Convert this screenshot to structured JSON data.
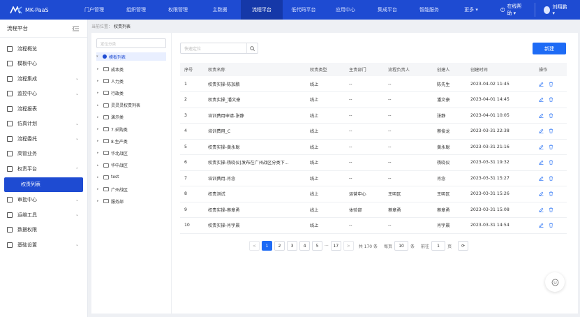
{
  "brand": {
    "name": "MK-PaaS"
  },
  "topnav": {
    "items": [
      "门户管理",
      "组织管理",
      "权限管理",
      "主数据",
      "流程平台",
      "低代码平台",
      "应用中心",
      "集成平台",
      "智能服务",
      "更多 ▾"
    ],
    "active_index": 4
  },
  "header_right": {
    "help": "在线帮助 ▾",
    "user": "刘翔鹏 ▾"
  },
  "sidebar": {
    "title": "流程平台",
    "items": [
      {
        "label": "流程概览",
        "chevron": ""
      },
      {
        "label": "模板中心",
        "chevron": ""
      },
      {
        "label": "流程集成",
        "chevron": "⌄"
      },
      {
        "label": "监控中心",
        "chevron": "⌄"
      },
      {
        "label": "流程报表",
        "chevron": ""
      },
      {
        "label": "仿真计划",
        "chevron": "⌄"
      },
      {
        "label": "流程委托",
        "chevron": "⌄"
      },
      {
        "label": "高管业务",
        "chevron": ""
      },
      {
        "label": "权责平台",
        "chevron": "⌄"
      }
    ],
    "sub_active": "权责列表",
    "items_after": [
      {
        "label": "审批中心",
        "chevron": "⌄"
      },
      {
        "label": "运维工具",
        "chevron": "⌄"
      },
      {
        "label": "数据权限",
        "chevron": ""
      },
      {
        "label": "基础设置",
        "chevron": "⌄"
      }
    ]
  },
  "breadcrumb": {
    "parent": "当前位置：",
    "current": "权责列表"
  },
  "tree": {
    "search_placeholder": "定位分类",
    "root": "模板列表",
    "nodes": [
      "成本类",
      "人力类",
      "行政类",
      "灵灵灵权责列表",
      "演示类",
      "7.采购类",
      "8.生产类",
      "华北战区",
      "华中战区",
      "test",
      "广州战区",
      "服务部"
    ]
  },
  "toolbar": {
    "search_placeholder": "快速定位",
    "new_label": "新建"
  },
  "table": {
    "headers": [
      "序号",
      "权责名称",
      "权责类型",
      "主责部门",
      "流程负责人",
      "创建人",
      "创建时间",
      "操作"
    ],
    "rows": [
      [
        "1",
        "权责实操-陈加鹏",
        "线上",
        "--",
        "--",
        "陈先生",
        "2023-04-02 11:45"
      ],
      [
        "2",
        "权责实操_潘文豪",
        "线上",
        "--",
        "--",
        "潘文豪",
        "2023-04-01 14:45"
      ],
      [
        "3",
        "培训费用申请-张静",
        "线上",
        "--",
        "--",
        "张静",
        "2023-04-01 10:05"
      ],
      [
        "4",
        "培训费用_C",
        "线上",
        "--",
        "--",
        "蔡俊龙",
        "2023-03-31 22:38"
      ],
      [
        "5",
        "权责实操-黄永聪",
        "线上",
        "--",
        "--",
        "黄永聪",
        "2023-03-31 21:16"
      ],
      [
        "6",
        "权责实操-杨晓仪[发布在广州战区分类下...",
        "线上",
        "--",
        "--",
        "杨晓仪",
        "2023-03-31 19:32"
      ],
      [
        "7",
        "培训费用-肖念",
        "线上",
        "--",
        "--",
        "肖念",
        "2023-03-31 15:27"
      ],
      [
        "8",
        "权责测试",
        "线上",
        "运营中心",
        "王明区",
        "王明区",
        "2023-03-31 15:26"
      ],
      [
        "9",
        "权责实操-蔡章勇",
        "线上",
        "体验部",
        "蔡章勇",
        "蔡章勇",
        "2023-03-31 15:08"
      ],
      [
        "10",
        "权责实操-肖宇晨",
        "线上",
        "--",
        "--",
        "肖宇晨",
        "2023-03-31 14:54"
      ]
    ]
  },
  "pagination": {
    "prev": "<",
    "pages": [
      "1",
      "2",
      "3",
      "4",
      "5"
    ],
    "ellipsis": "···",
    "last": "17",
    "next": ">",
    "total": "共 170 条",
    "per_page_label": "每页",
    "per_page": "10",
    "unit": "条",
    "goto_label": "前往",
    "goto_value": "1",
    "page_unit": "页",
    "refresh": "⟳"
  },
  "colors": {
    "brand": "#1e4bd2",
    "primary": "#1e6bf5"
  }
}
